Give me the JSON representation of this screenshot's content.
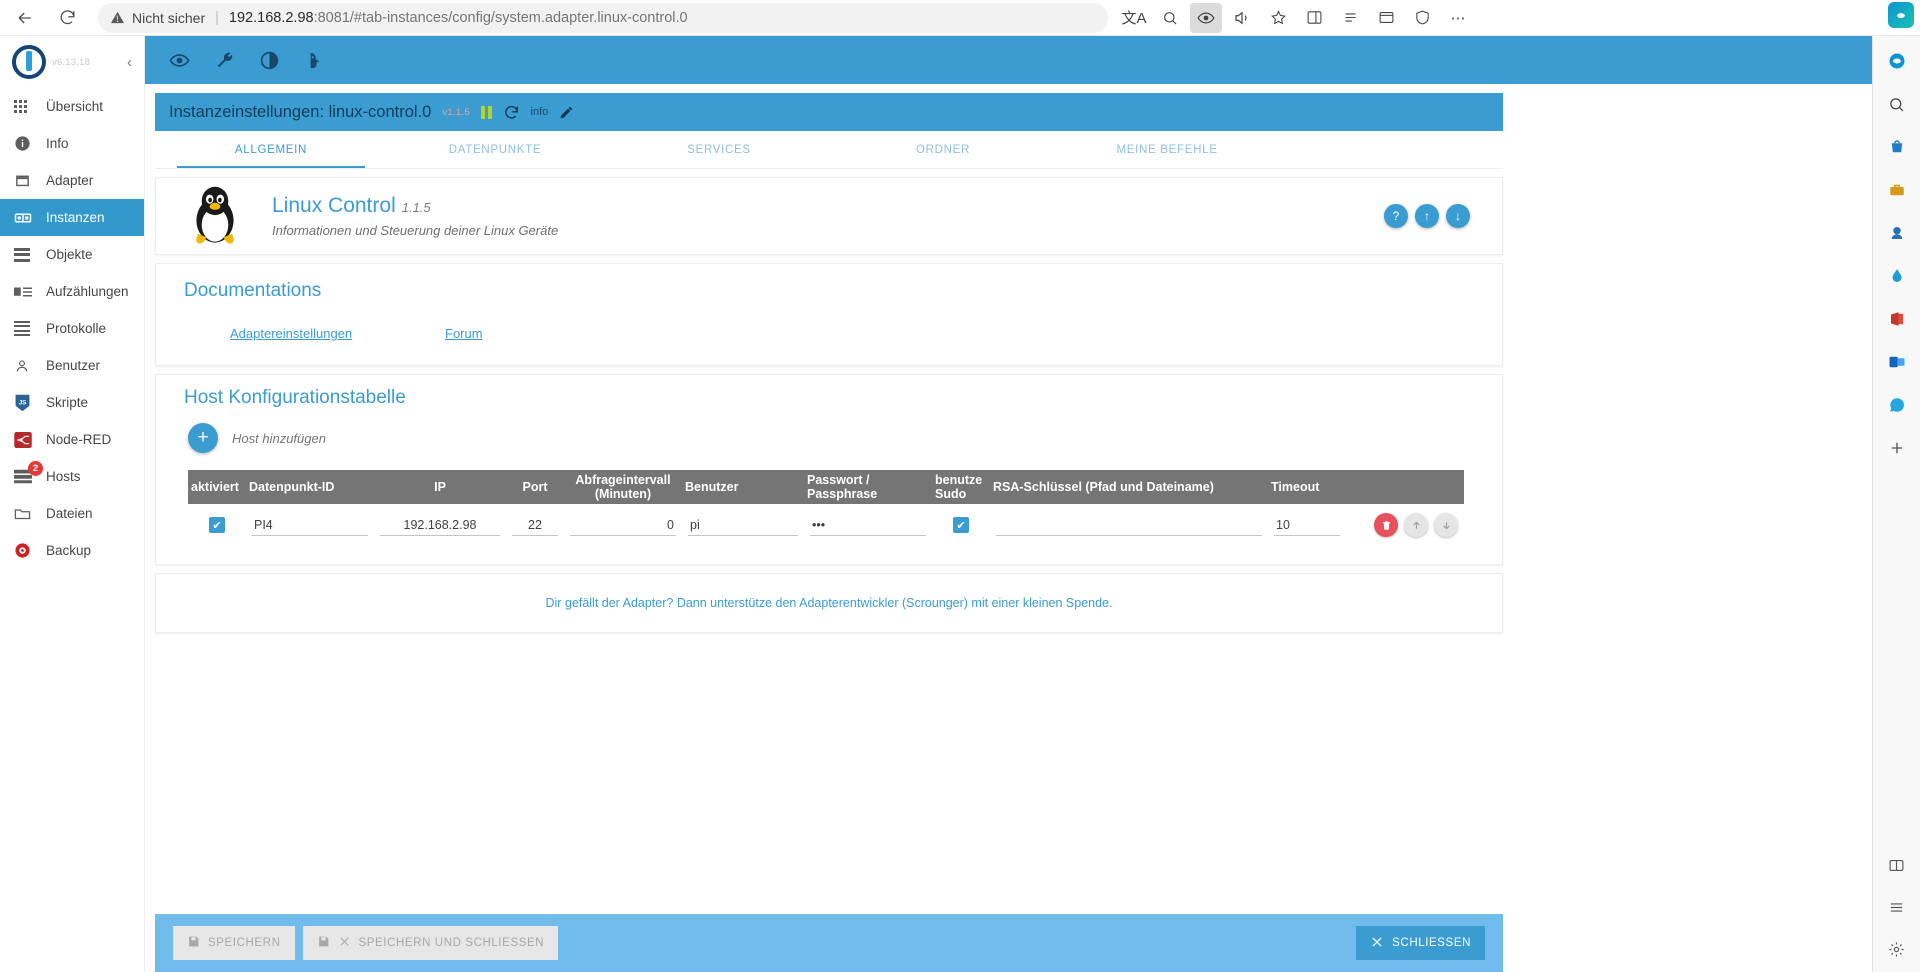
{
  "browser": {
    "back_label": "Back",
    "reload_label": "Reload",
    "security_text": "Nicht sicher",
    "url_host": "192.168.2.98",
    "url_rest": ":8081/#tab-instances/config/system.adapter.linux-control.0",
    "icons": [
      "translate-icon",
      "search-icon",
      "read-aloud-eye-icon",
      "read-aloud-icon",
      "favorite-star-icon",
      "split-screen-icon",
      "collections-icon",
      "browser-essentials-icon",
      "shield-icon",
      "more-icon"
    ]
  },
  "edge_sidebar": {
    "icons": [
      "copilot-icon",
      "search-icon",
      "shopping-icon",
      "tools-icon",
      "games-icon",
      "drop-icon",
      "office-icon",
      "outlook-icon",
      "whatsapp-icon",
      "add-icon",
      "split-icon",
      "customize-icon",
      "settings-icon"
    ]
  },
  "sidebar": {
    "version": "v6.13.18",
    "collapse_label": "‹",
    "items": [
      {
        "label": "Übersicht",
        "icon": "grid-icon",
        "selected": false,
        "badge": ""
      },
      {
        "label": "Info",
        "icon": "info-icon",
        "selected": false,
        "badge": ""
      },
      {
        "label": "Adapter",
        "icon": "store-icon",
        "selected": false,
        "badge": ""
      },
      {
        "label": "Instanzen",
        "icon": "instances-icon",
        "selected": true,
        "badge": ""
      },
      {
        "label": "Objekte",
        "icon": "objects-icon",
        "selected": false,
        "badge": ""
      },
      {
        "label": "Aufzählungen",
        "icon": "enums-icon",
        "selected": false,
        "badge": ""
      },
      {
        "label": "Protokolle",
        "icon": "log-icon",
        "selected": false,
        "badge": ""
      },
      {
        "label": "Benutzer",
        "icon": "user-icon",
        "selected": false,
        "badge": ""
      },
      {
        "label": "Skripte",
        "icon": "javascript-icon",
        "selected": false,
        "badge": ""
      },
      {
        "label": "Node-RED",
        "icon": "node-red-icon",
        "selected": false,
        "badge": ""
      },
      {
        "label": "Hosts",
        "icon": "hosts-icon",
        "selected": false,
        "badge": "2"
      },
      {
        "label": "Dateien",
        "icon": "files-icon",
        "selected": false,
        "badge": ""
      },
      {
        "label": "Backup",
        "icon": "backup-icon",
        "selected": false,
        "badge": ""
      }
    ]
  },
  "topbar": {
    "icons": [
      "eye-icon",
      "wrench-icon",
      "contrast-icon",
      "expert-mode-icon"
    ]
  },
  "config_header": {
    "title": "Instanzeinstellungen: linux-control.0",
    "version": "v1.1.5",
    "pause_icon": "pause-icon",
    "refresh_icon": "refresh-icon",
    "info_label": "info",
    "edit_icon": "pencil-icon"
  },
  "tabs": [
    {
      "label": "ALLGEMEIN",
      "active": true
    },
    {
      "label": "DATENPUNKTE",
      "active": false
    },
    {
      "label": "SERVICES",
      "active": false
    },
    {
      "label": "ORDNER",
      "active": false
    },
    {
      "label": "MEINE BEFEHLE",
      "active": false
    }
  ],
  "adapter": {
    "name": "Linux Control",
    "version": "1.1.5",
    "description": "Informationen und Steuerung deiner Linux Geräte",
    "logo": "tux-penguin-icon",
    "actions": [
      {
        "icon": "help-icon",
        "glyph": "?"
      },
      {
        "icon": "upload-icon",
        "glyph": "↑"
      },
      {
        "icon": "download-icon",
        "glyph": "↓"
      }
    ]
  },
  "documentation": {
    "title": "Documentations",
    "links": [
      {
        "label": "Adaptereinstellungen"
      },
      {
        "label": "Forum"
      }
    ]
  },
  "host_table": {
    "title": "Host Konfigurationstabelle",
    "add_label": "Host hinzufügen",
    "add_icon": "plus-icon",
    "columns": [
      "aktiviert",
      "Datenpunkt-ID",
      "IP",
      "Port",
      "Abfrageintervall (Minuten)",
      "Benutzer",
      "Passwort / Passphrase",
      "benutze Sudo",
      "RSA-Schlüssel (Pfad und Dateiname)",
      "Timeout"
    ],
    "rows": [
      {
        "enabled": true,
        "datapoint_id": "PI4",
        "ip": "192.168.2.98",
        "port": "22",
        "interval": "0",
        "user": "pi",
        "password": "•••",
        "sudo": true,
        "rsa_key": "",
        "timeout": "10",
        "actions": [
          "delete-icon",
          "move-up-icon",
          "move-down-icon"
        ]
      }
    ]
  },
  "donate": {
    "text": "Dir gefällt der Adapter? Dann unterstütze den Adapterentwickler (Scrounger) mit einer kleinen Spende."
  },
  "footer": {
    "save_label": "SPEICHERN",
    "save_close_label": "SPEICHERN UND SCHLIESSEN",
    "close_label": "SCHLIESSEN",
    "save_icon": "save-icon",
    "close_icon": "close-icon"
  },
  "colors": {
    "accent": "#3b9cd2",
    "footer_bg": "#72bced",
    "table_header": "#757575",
    "danger": "#e8505b",
    "badge": "#e53935"
  }
}
